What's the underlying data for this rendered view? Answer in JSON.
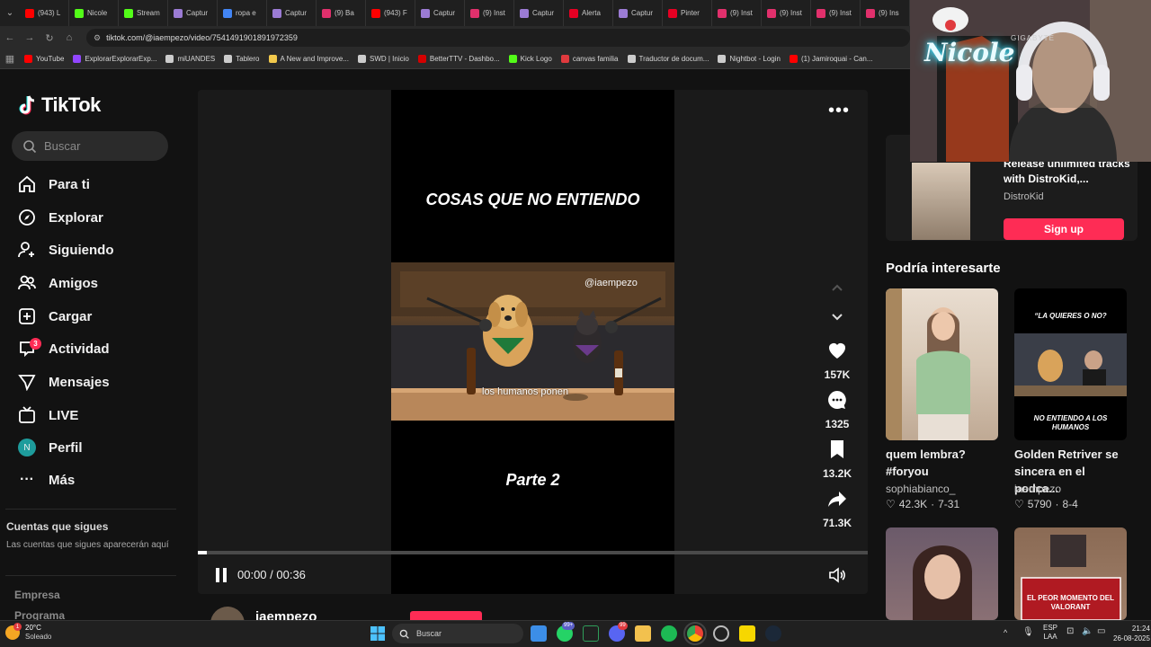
{
  "browser": {
    "tabs": [
      {
        "label": "(943) L",
        "color": "#ff0000"
      },
      {
        "label": "Nicole",
        "color": "#53fc18"
      },
      {
        "label": "Stream",
        "color": "#53fc18"
      },
      {
        "label": "Captur",
        "color": "#9b7bd4"
      },
      {
        "label": "ropa e",
        "color": "#4285f4"
      },
      {
        "label": "Captur",
        "color": "#9b7bd4"
      },
      {
        "label": "(9) Ba",
        "color": "#e1306c"
      },
      {
        "label": "(943) F",
        "color": "#ff0000"
      },
      {
        "label": "Captur",
        "color": "#9b7bd4"
      },
      {
        "label": "(9) Inst",
        "color": "#e1306c"
      },
      {
        "label": "Captur",
        "color": "#9b7bd4"
      },
      {
        "label": "Alerta",
        "color": "#e60023"
      },
      {
        "label": "Captur",
        "color": "#9b7bd4"
      },
      {
        "label": "Pinter",
        "color": "#e60023"
      },
      {
        "label": "(9) Inst",
        "color": "#e1306c"
      },
      {
        "label": "(9) Inst",
        "color": "#e1306c"
      },
      {
        "label": "(9) Inst",
        "color": "#e1306c"
      },
      {
        "label": "(9) Ins",
        "color": "#e1306c"
      }
    ],
    "url": "tiktok.com/@iaempezo/video/7541491901891972359",
    "bookmarks": [
      {
        "label": "YouTube",
        "color": "#ff0000"
      },
      {
        "label": "ExplorarExplorarExp...",
        "color": "#9146ff"
      },
      {
        "label": "miUANDES",
        "color": "#cccccc"
      },
      {
        "label": "Tablero",
        "color": "#cccccc"
      },
      {
        "label": "A New and Improve...",
        "color": "#f2c94c"
      },
      {
        "label": "SWD | Inicio",
        "color": "#cccccc"
      },
      {
        "label": "BetterTTV - Dashbo...",
        "color": "#d50000"
      },
      {
        "label": "Kick Logo",
        "color": "#53fc18"
      },
      {
        "label": "canvas familia",
        "color": "#e03a3e"
      },
      {
        "label": "Traductor de docum...",
        "color": "#cccccc"
      },
      {
        "label": "Nightbot - Login",
        "color": "#cccccc"
      },
      {
        "label": "(1) Jamiroquai - Can...",
        "color": "#ff0000"
      }
    ]
  },
  "sidebar": {
    "logo": "TikTok",
    "search_placeholder": "Buscar",
    "items": [
      {
        "label": "Para ti"
      },
      {
        "label": "Explorar"
      },
      {
        "label": "Siguiendo"
      },
      {
        "label": "Amigos"
      },
      {
        "label": "Cargar"
      },
      {
        "label": "Actividad",
        "badge": "3"
      },
      {
        "label": "Mensajes"
      },
      {
        "label": "LIVE"
      },
      {
        "label": "Perfil",
        "avatar": "N"
      },
      {
        "label": "Más"
      }
    ],
    "following_heading": "Cuentas que sigues",
    "following_note": "Las cuentas que sigues aparecerán aquí",
    "footer_links": [
      "Empresa",
      "Programa"
    ]
  },
  "video": {
    "title_text": "COSAS QUE NO ENTIENDO",
    "part_text": "Parte 2",
    "watermark": "@iaempezo",
    "subtitle": "los humanos ponen",
    "time": "00:00 / 00:36",
    "progress": 0.013,
    "author": "iaempezo",
    "actions": {
      "likes": "157K",
      "comments": "1325",
      "saves": "13.2K",
      "shares": "71.3K"
    }
  },
  "ad": {
    "title": "Release unlimited tracks with DistroKid,...",
    "brand": "DistroKid",
    "cta": "Sign up"
  },
  "recommend": {
    "heading": "Podría interesarte",
    "items": [
      {
        "title": "quem lembra? #foryou",
        "author": "sophiabianco_",
        "likes": "42.3K",
        "date": "7-31"
      },
      {
        "title": "Golden Retriver se sincera en el podca...",
        "author": "iaempezo",
        "likes": "5790",
        "date": "8-4",
        "thumb_top": "“LA QUIERES O NO?",
        "thumb_bottom": "NO ENTIENDO A LOS HUMANOS"
      },
      {
        "title": "",
        "author": "",
        "likes": "",
        "date": ""
      },
      {
        "title": "",
        "author": "",
        "likes": "",
        "date": "",
        "thumb_bottom": "EL PEOR MOMENTO DEL VALORANT"
      }
    ]
  },
  "webcam": {
    "neon_text": "Nicole",
    "brand_text": "GIGABYTE"
  },
  "taskbar": {
    "temp": "20°C",
    "weather": "Soleado",
    "weather_badge": "1",
    "search_placeholder": "Buscar",
    "badge_whatsapp": "99+",
    "badge_discord": "99",
    "lang": "ESP",
    "lang2": "LAA",
    "time": "21:24",
    "date": "26-08-2025"
  }
}
